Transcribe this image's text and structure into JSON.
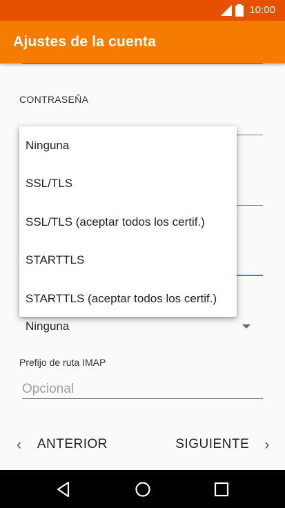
{
  "status_bar": {
    "time": "10:00"
  },
  "app_bar": {
    "title": "Ajustes de la cuenta"
  },
  "form": {
    "password_label": "CONTRASEÑA",
    "security_type_value": "Ninguna",
    "imap_path_label": "Prefijo de ruta IMAP",
    "imap_path_placeholder": "Opcional",
    "imap_path_value": ""
  },
  "dropdown": {
    "options": [
      {
        "label": "Ninguna"
      },
      {
        "label": "SSL/TLS"
      },
      {
        "label": "SSL/TLS (aceptar todos los certif.)"
      },
      {
        "label": "STARTTLS"
      },
      {
        "label": "STARTTLS (aceptar todos los certif.)"
      }
    ]
  },
  "footer": {
    "previous_label": "ANTERIOR",
    "next_label": "SIGUIENTE"
  },
  "colors": {
    "status_bar": "#e65100",
    "app_bar": "#f57c00",
    "focus_underline": "#3b7ddd"
  },
  "icons": {
    "signal": "signal-icon",
    "battery": "battery-icon",
    "back": "back-triangle-icon",
    "home": "home-circle-icon",
    "recents": "recents-square-icon"
  }
}
